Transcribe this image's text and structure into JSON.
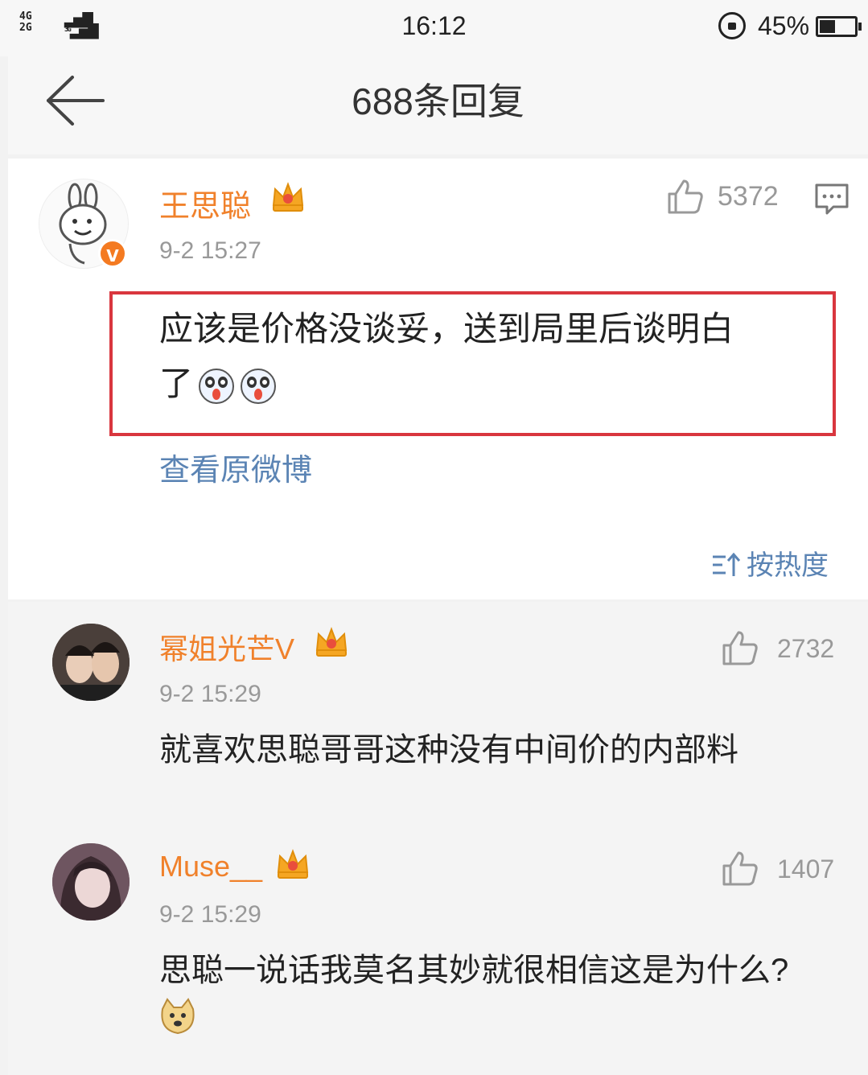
{
  "status_bar": {
    "network_top": "4G",
    "network_bottom": "2G",
    "network_3g": "3G",
    "time": "16:12",
    "battery_percent": "45%",
    "battery_level": 0.45
  },
  "header": {
    "title": "688条回复",
    "back_icon": "arrow-left-icon"
  },
  "main_post": {
    "author": "王思聪",
    "verified_badge": "V",
    "timestamp": "9-2 15:27",
    "likes": "5372",
    "text_line1": "应该是价格没谈妥，送到局里后谈明白",
    "text_line2": "了",
    "view_original": "查看原微博",
    "sort_label": "按热度",
    "highlight_color": "#d9363e"
  },
  "replies": [
    {
      "author": "幂姐光芒V",
      "timestamp": "9-2 15:29",
      "likes": "2732",
      "text": "就喜欢思聪哥哥这种没有中间价的内部料"
    },
    {
      "author": "Muse__",
      "timestamp": "9-2 15:29",
      "likes": "1407",
      "text": "思聪一说话我莫名其妙就很相信这是为什么?"
    }
  ],
  "colors": {
    "username": "#f0812b",
    "link": "#5b84b4",
    "meta": "#999999",
    "badge": "#f47a21"
  }
}
